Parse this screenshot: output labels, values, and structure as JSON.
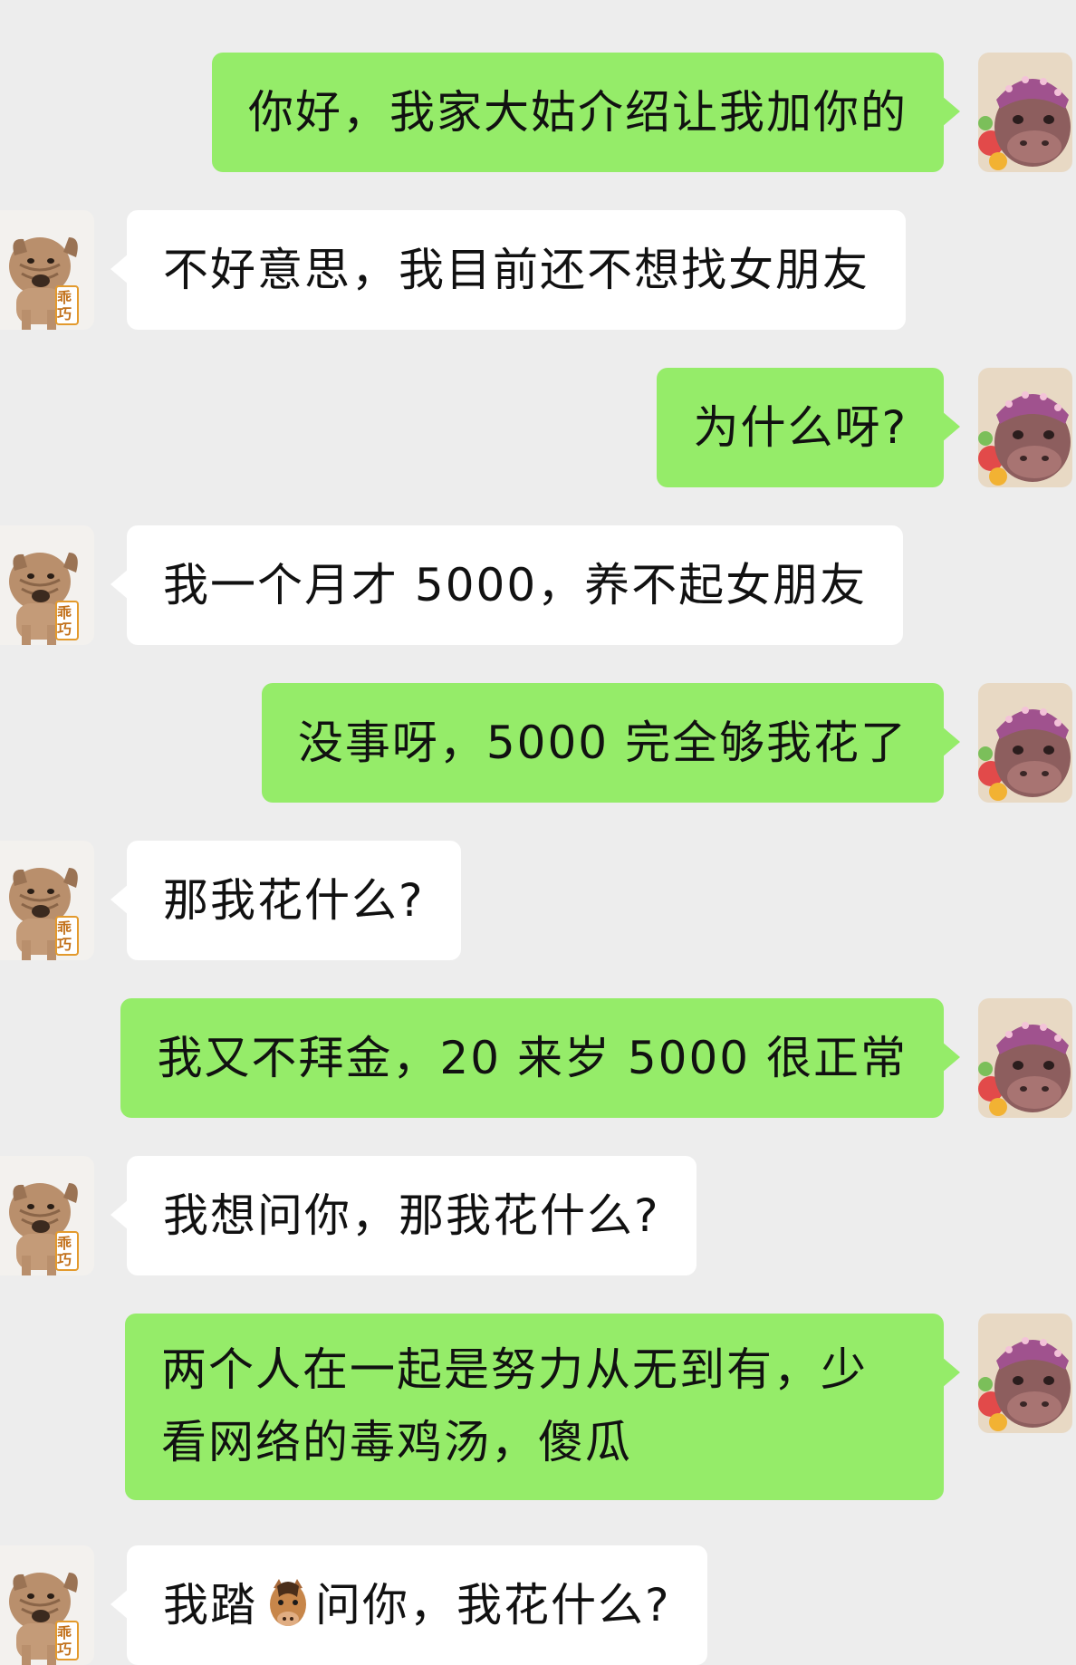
{
  "chat": {
    "messages": [
      {
        "sender": "me",
        "text": "你好，我家大姑介绍让我加你的"
      },
      {
        "sender": "other",
        "text": "不好意思，我目前还不想找女朋友"
      },
      {
        "sender": "me",
        "text": "为什么呀?"
      },
      {
        "sender": "other",
        "text": "我一个月才 5000，养不起女朋友"
      },
      {
        "sender": "me",
        "text": "没事呀，5000 完全够我花了"
      },
      {
        "sender": "other",
        "text": "那我花什么?"
      },
      {
        "sender": "me",
        "text": "我又不拜金，20 来岁 5000 很正常"
      },
      {
        "sender": "other",
        "text": "我想问你，那我花什么?"
      },
      {
        "sender": "me",
        "text": "两个人在一起是努力从无到有，少看网络的毒鸡汤，傻瓜"
      },
      {
        "sender": "other",
        "text_before": "我踏",
        "emoji": "horse-emoji",
        "text_after": "问你，我花什么?"
      }
    ]
  },
  "avatars": {
    "me": {
      "icon": "hippo-avatar"
    },
    "other": {
      "icon": "shar-pei-dog-avatar",
      "badge_text": "乖巧"
    }
  },
  "colors": {
    "background": "#ededed",
    "my_bubble": "#95ec69",
    "their_bubble": "#ffffff",
    "text": "#111111"
  }
}
